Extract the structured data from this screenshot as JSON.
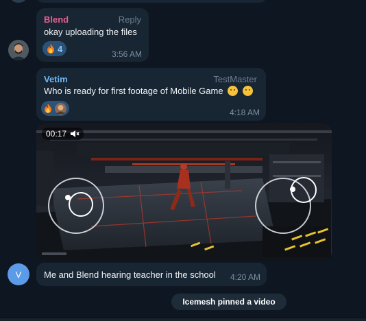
{
  "messages": [
    {
      "sender": "Blend",
      "sender_color": "#e85d8f",
      "reply_label": "Reply",
      "text": "okay uploading the files",
      "reaction_emoji": "fire-emoji",
      "reaction_count": "4",
      "time": "3:56 AM"
    },
    {
      "sender": "Vetim",
      "sender_color": "#6fb7f5",
      "forwarded_from": "TestMaster",
      "text": "Who is ready for first footage of Mobile Game",
      "text_emoji": "thinking-face-emoji",
      "reactions": [
        "fire-emoji",
        "reactor-avatar"
      ],
      "time": "4:18 AM"
    },
    {
      "video_time": "00:17",
      "video_icon": "muted-speaker-icon"
    },
    {
      "avatar_letter": "V",
      "text": "Me and Blend hearing teacher in the school",
      "time": "4:20 AM"
    }
  ],
  "system": {
    "pinned": "Icemesh pinned a video"
  },
  "colors": {
    "background": "#0e1621",
    "bubble": "#182533",
    "reaction": "#2b5278",
    "avatar_v": "#5b9be8"
  }
}
